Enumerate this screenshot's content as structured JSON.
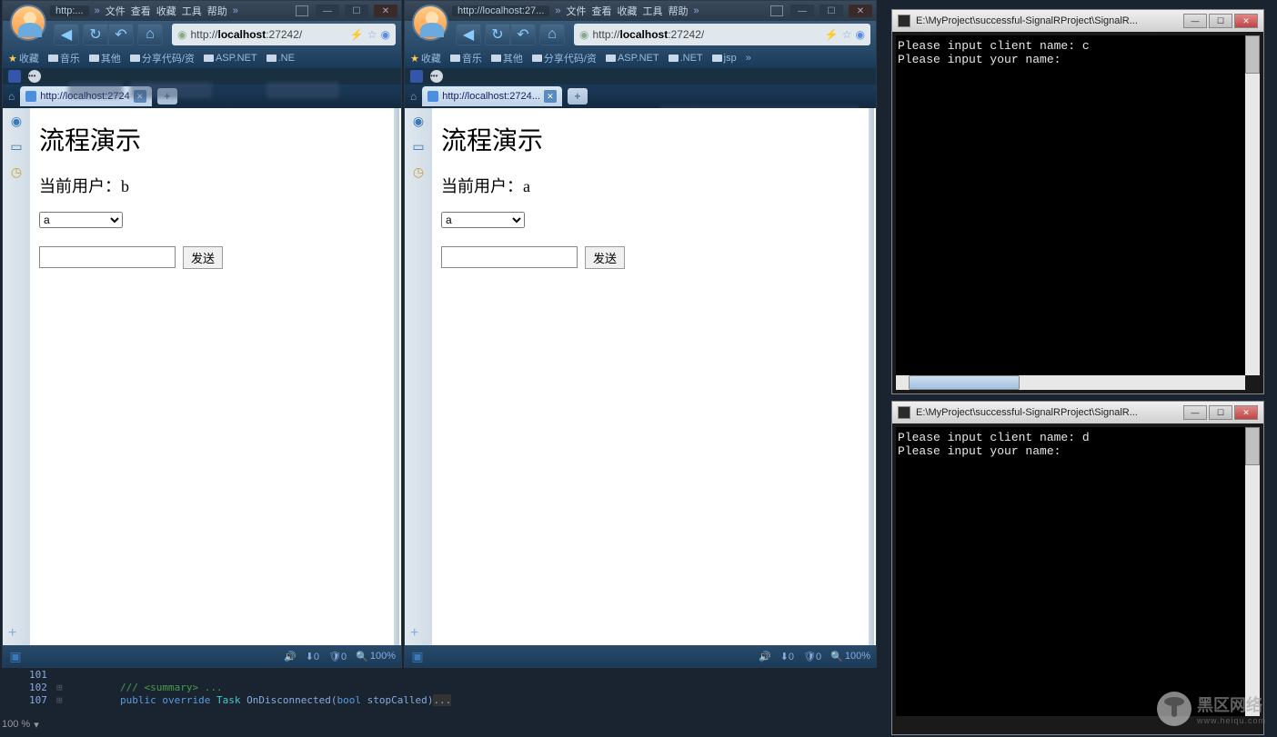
{
  "browser1": {
    "title": "http:...",
    "menu": {
      "file": "文件",
      "view": "查看",
      "fav": "收藏",
      "tools": "工具",
      "help": "帮助"
    },
    "url_full": "http://localhost:27242/",
    "url_host": "localhost",
    "bookmarks": {
      "fav": "收藏",
      "music": "音乐",
      "other": "其他",
      "share": "分享代码/资",
      "aspnet": "ASP.NET",
      "net": ".NE"
    },
    "tab_label": "http://localhost:2724",
    "page": {
      "h1": "流程演示",
      "user_label": "当前用户：b",
      "select": "a",
      "send": "发送"
    },
    "zoom": "100%"
  },
  "browser2": {
    "title": "http://localhost:27...",
    "menu": {
      "file": "文件",
      "view": "查看",
      "fav": "收藏",
      "tools": "工具",
      "help": "帮助"
    },
    "url_full": "http://localhost:27242/",
    "url_host": "localhost",
    "bookmarks": {
      "fav": "收藏",
      "music": "音乐",
      "other": "其他",
      "share": "分享代码/资",
      "aspnet": "ASP.NET",
      "net": ".NET",
      "jsp": "jsp"
    },
    "tab_label": "http://localhost:2724...",
    "page": {
      "h1": "流程演示",
      "user_label": "当前用户：a",
      "select": "a",
      "send": "发送"
    },
    "zoom": "100%"
  },
  "console1": {
    "title": "E:\\MyProject\\successful-SignalRProject\\SignalR...",
    "line1": "Please input client name: c",
    "line2": "Please input your name:"
  },
  "console2": {
    "title": "E:\\MyProject\\successful-SignalRProject\\SignalR...",
    "line1": "Please input client name: d",
    "line2": "Please input your name:"
  },
  "code": {
    "ln1": "101",
    "ln2": "102",
    "ln3": "107",
    "summary": "/// <summary> ...",
    "public": "public",
    "override": "override",
    "task": "Task",
    "method": "OnDisconnected",
    "bool": "bool",
    "param": "stopCalled",
    "zoom": "100 %"
  },
  "watermark": {
    "main": "黑区网络",
    "sub": "www.heiqu.com"
  },
  "status_icons": {
    "sound": "🔊",
    "block": "⬇0",
    "shield": "🛡0",
    "search": "🔍"
  }
}
